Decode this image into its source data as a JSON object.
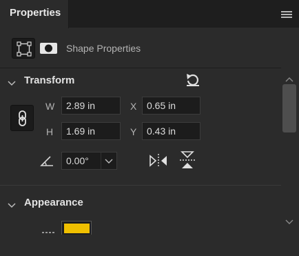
{
  "panel": {
    "tab_title": "Properties",
    "menu_icon": "hamburger-menu-icon"
  },
  "shape_header": {
    "label": "Shape Properties",
    "bounds_icon": "bounding-box-icon",
    "mask_icon": "mask-icon"
  },
  "transform": {
    "title": "Transform",
    "reset_icon": "reset-rotate-icon",
    "link_icon": "constrain-proportions-link-icon",
    "width": {
      "label": "W",
      "value": "2.89 in"
    },
    "x": {
      "label": "X",
      "value": "0.65 in"
    },
    "height": {
      "label": "H",
      "value": "1.69 in"
    },
    "y": {
      "label": "Y",
      "value": "0.43 in"
    },
    "angle": {
      "icon": "angle-icon",
      "value": "0.00°"
    },
    "flip_horizontal_icon": "flip-horizontal-icon",
    "flip_vertical_icon": "flip-vertical-icon"
  },
  "appearance": {
    "title": "Appearance",
    "fill_color": "#f0c000"
  },
  "colors": {
    "panel_bg": "#2b2b2b",
    "field_bg": "#1c1c1c",
    "accent_fill": "#f0c000"
  }
}
